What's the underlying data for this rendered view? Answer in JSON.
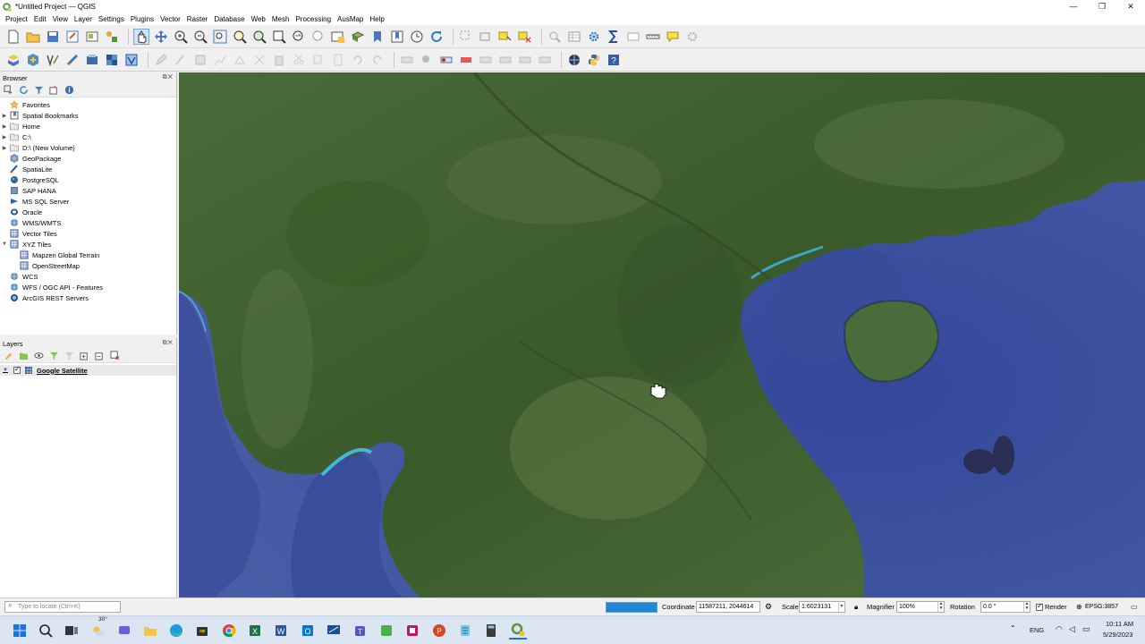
{
  "window": {
    "title": "*Untitled Project — QGIS",
    "controls": [
      "—",
      "❐",
      "✕"
    ]
  },
  "menu": [
    "Project",
    "Edit",
    "View",
    "Layer",
    "Settings",
    "Plugins",
    "Vector",
    "Raster",
    "Database",
    "Web",
    "Mesh",
    "Processing",
    "AusMap",
    "Help"
  ],
  "browser": {
    "title": "Browser",
    "items": [
      {
        "label": "Favorites",
        "icon": "star-icon",
        "arrow": ""
      },
      {
        "label": "Spatial Bookmarks",
        "icon": "bookmark-icon",
        "arrow": "▶"
      },
      {
        "label": "Home",
        "icon": "folder-icon",
        "arrow": "▶"
      },
      {
        "label": "C:\\",
        "icon": "drive-icon",
        "arrow": "▶"
      },
      {
        "label": "D:\\ (New Volume)",
        "icon": "drive-icon",
        "arrow": "▶"
      },
      {
        "label": "GeoPackage",
        "icon": "geopackage-icon",
        "arrow": ""
      },
      {
        "label": "SpatiaLite",
        "icon": "spatialite-icon",
        "arrow": ""
      },
      {
        "label": "PostgreSQL",
        "icon": "postgresql-icon",
        "arrow": ""
      },
      {
        "label": "SAP HANA",
        "icon": "saphana-icon",
        "arrow": ""
      },
      {
        "label": "MS SQL Server",
        "icon": "mssql-icon",
        "arrow": ""
      },
      {
        "label": "Oracle",
        "icon": "oracle-icon",
        "arrow": ""
      },
      {
        "label": "WMS/WMTS",
        "icon": "wms-icon",
        "arrow": ""
      },
      {
        "label": "Vector Tiles",
        "icon": "vector-tiles-icon",
        "arrow": ""
      },
      {
        "label": "XYZ Tiles",
        "icon": "xyz-tiles-icon",
        "arrow": "▼"
      }
    ],
    "xyz_children": [
      "Mapzen Global Terrain",
      "OpenStreetMap"
    ],
    "more": [
      {
        "label": "WCS",
        "icon": "wcs-icon"
      },
      {
        "label": "WFS / OGC API - Features",
        "icon": "wfs-icon"
      },
      {
        "label": "ArcGIS REST Servers",
        "icon": "arcgis-icon"
      }
    ]
  },
  "layers": {
    "title": "Layers",
    "items": [
      {
        "label": "Google Satellite",
        "checked": true
      }
    ]
  },
  "status": {
    "locate_placeholder": "Type to locate (Ctrl+K)",
    "progress": 1.0,
    "coordinate_label": "Coordinate",
    "coordinate_value": "11587211, 2044614",
    "scale_label": "Scale",
    "scale_value": "1:6023131",
    "magnifier_label": "Magnifier",
    "magnifier_value": "100%",
    "rotation_label": "Rotation",
    "rotation_value": "0.0 °",
    "render_label": "Render",
    "crs_label": "EPSG:3857"
  },
  "taskbar": {
    "weather": "30°",
    "language": "ENG",
    "time": "10:11 AM",
    "date": "5/29/2023",
    "apps": [
      "start-icon",
      "search-icon",
      "task-view-icon",
      "weather-icon",
      "chat-icon",
      "file-explorer-icon",
      "edge-icon",
      "store-icon",
      "chrome-icon",
      "excel-icon",
      "word-icon",
      "outlook-icon",
      "remote-desktop-icon",
      "teams-icon",
      "green-app-icon",
      "snip-icon",
      "powerpoint-icon",
      "notepad-icon",
      "calculator-icon",
      "qgis-icon"
    ]
  },
  "colors": {
    "accent": "#1f86d8",
    "qgis_green": "#589632",
    "sea": "#3d4e9a",
    "land": "#3e5a2c"
  }
}
